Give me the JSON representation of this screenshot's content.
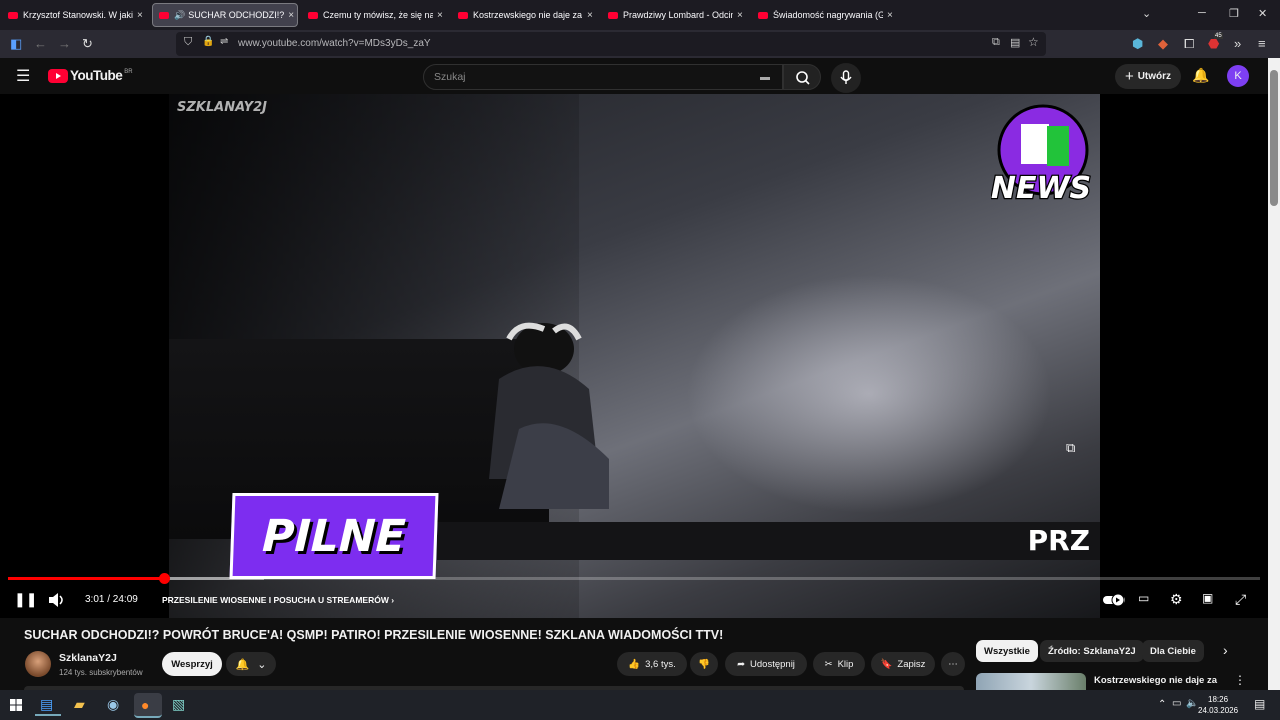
{
  "browser": {
    "tabs": [
      {
        "title": "Krzysztof Stanowski. W jakiej sp"
      },
      {
        "title": "SUCHAR ODCHODZI!? POW"
      },
      {
        "title": "Czemu ty mówisz, że się na cieb"
      },
      {
        "title": "Kostrzewskiego nie daje za wyg"
      },
      {
        "title": "Prawdziwy Lombard - Odcinek"
      },
      {
        "title": "Świadomość nagrywania (Giełd"
      }
    ],
    "url": "www.youtube.com/watch?v=MDs3yDs_zaY",
    "badge": "45",
    "colors": {
      "tabbar": "#1c1b22",
      "toolbar": "#2b2a33",
      "accent": "#ff0033"
    }
  },
  "youtube": {
    "logo": "YouTube",
    "region": "BR",
    "search_placeholder": "Szukaj",
    "create_label": "Utwórz",
    "avatar_letter": "K"
  },
  "player": {
    "watermark": "SZKLANAY2J",
    "news_badge": "NEWS",
    "banner_text": "PILNE",
    "ticker_text": "PRZ",
    "time": "3:01 / 24:09",
    "chapter": "PRZESILENIE WIOSENNE I POSUCHA U STREAMERÓW",
    "played_fraction": 0.1246,
    "buffered_fraction": 0.2045
  },
  "video": {
    "title": "SUCHAR ODCHODZI!? POWRÓT BRUCE'A! QSMP! PATIRO! PRZESILENIE WIOSENNE! SZKLANA WIADOMOŚCI TTV!",
    "channel": "SzklanaY2J",
    "subscribers": "124 tys. subskrybentów",
    "support_label": "Wesprzyj",
    "likes": "3,6 tys.",
    "share_label": "Udostępnij",
    "clip_label": "Klip",
    "save_label": "Zapisz"
  },
  "sidebar": {
    "chips": [
      "Wszystkie",
      "Źródło: SzklanaY2J",
      "Dla Ciebie"
    ],
    "rec_title": "Kostrzewskiego nie daje za wygraną"
  },
  "taskbar": {
    "time": "18:26",
    "date": "24.03.2026"
  }
}
